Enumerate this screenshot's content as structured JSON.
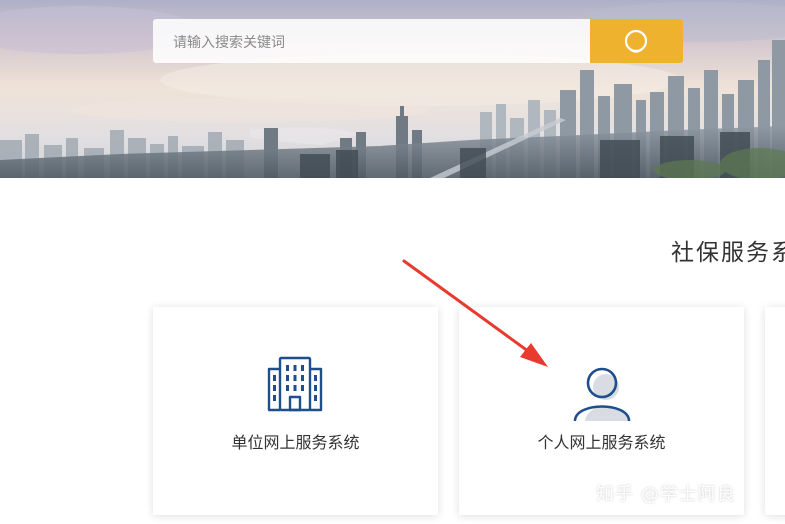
{
  "search": {
    "placeholder": "请输入搜索关键词",
    "button_icon": "search-icon"
  },
  "section": {
    "title": "社保服务系"
  },
  "cards": [
    {
      "label": "单位网上服务系统",
      "icon": "building-icon"
    },
    {
      "label": "个人网上服务系统",
      "icon": "user-icon"
    },
    {
      "label": ""
    }
  ],
  "annotation": {
    "arrow_color": "#e83a2e"
  },
  "watermark": {
    "text": "知乎 @学士阿良"
  },
  "colors": {
    "accent": "#efb22f",
    "icon": "#1e4e8c",
    "text": "#333333"
  }
}
